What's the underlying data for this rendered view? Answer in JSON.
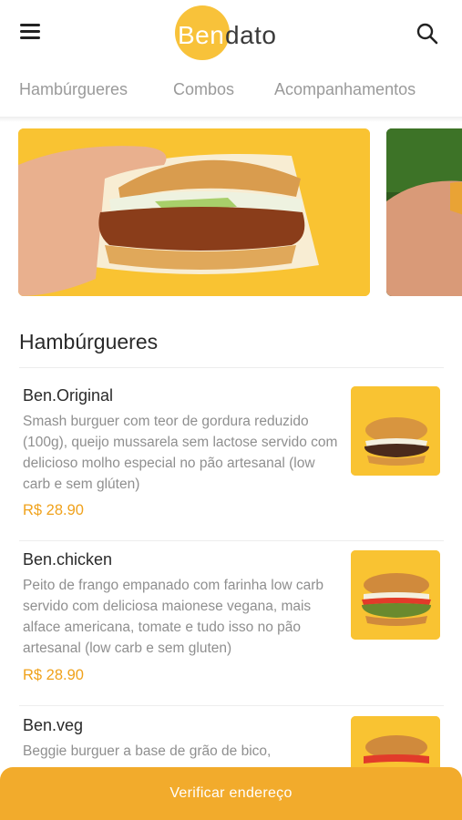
{
  "header": {
    "logo": {
      "part1": "Ben",
      "part2": "dato"
    },
    "menu_icon": "hamburger-menu-icon",
    "search_icon": "search-icon"
  },
  "tabs": [
    {
      "label": "Hambúrgueres"
    },
    {
      "label": "Combos"
    },
    {
      "label": "Acompanhamentos"
    }
  ],
  "section": {
    "title": "Hambúrgueres"
  },
  "products": [
    {
      "name": "Ben.Original",
      "description": "Smash burguer com teor de gordura reduzido (100g), queijo mussarela sem lactose servido com delicioso molho especial no pão artesanal (low carb e sem glúten)",
      "price": "R$ 28.90"
    },
    {
      "name": "Ben.chicken",
      "description": "Peito de frango empanado com farinha low carb servido com deliciosa maionese vegana, mais alface americana, tomate e tudo isso no pão artesanal (low carb e sem gluten)",
      "price": "R$ 28.90"
    },
    {
      "name": "Ben.veg",
      "description": "Beggie burguer a base de grão de bico,",
      "price": ""
    }
  ],
  "cta": {
    "label": "Verificar endereço"
  },
  "colors": {
    "brand_yellow": "#f8c23a",
    "accent_orange": "#f2ab2c",
    "price_orange": "#f0a21c"
  }
}
